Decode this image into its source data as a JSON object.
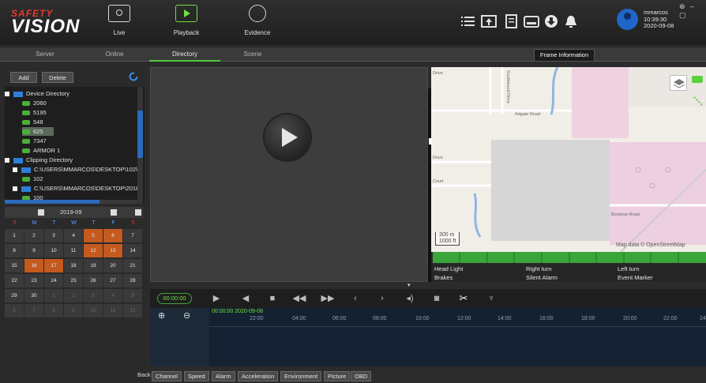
{
  "app": {
    "logo_top": "SAFETY",
    "logo_main": "VISION",
    "nav": [
      {
        "label": "Live"
      },
      {
        "label": "Playback"
      },
      {
        "label": "Evidence"
      }
    ]
  },
  "user": {
    "name": "mmarcos",
    "time": "10:39:30",
    "date": "2020-09-08"
  },
  "window_controls": "⊕ – ▢",
  "subtabs": [
    "Server",
    "Online",
    "Directory",
    "Scene"
  ],
  "tooltip": "Frame Information",
  "left": {
    "add_label": "Add",
    "delete_label": "Delete",
    "tree": [
      {
        "label": "Device Directory",
        "type": "folder"
      },
      {
        "label": "2060",
        "type": "vehicle"
      },
      {
        "label": "5195",
        "type": "vehicle"
      },
      {
        "label": "548",
        "type": "vehicle"
      },
      {
        "label": "625",
        "type": "vehicle"
      },
      {
        "label": "7347",
        "type": "vehicle"
      },
      {
        "label": "ARMOR 1",
        "type": "vehicle"
      },
      {
        "label": "Clipping Directory",
        "type": "folder"
      },
      {
        "label": "C:\\USERS\\MMARCOS\\DESKTOP\\102\\",
        "type": "folder"
      },
      {
        "label": "102",
        "type": "vehicle"
      },
      {
        "label": "C:\\USERS\\MMARCOS\\DESKTOP\\2018_",
        "type": "folder"
      },
      {
        "label": "100",
        "type": "vehicle"
      }
    ],
    "calendar": {
      "month": "2019-09",
      "dow": [
        "S",
        "M",
        "T",
        "W",
        "T",
        "F",
        "S"
      ],
      "weeks": [
        [
          "1",
          "2",
          "3",
          "4",
          "5",
          "6",
          "7"
        ],
        [
          "8",
          "9",
          "10",
          "11",
          "12",
          "13",
          "14"
        ],
        [
          "15",
          "16",
          "17",
          "18",
          "19",
          "20",
          "21"
        ],
        [
          "22",
          "23",
          "24",
          "25",
          "26",
          "27",
          "28"
        ],
        [
          "29",
          "30",
          "1",
          "2",
          "3",
          "4",
          "5"
        ],
        [
          "6",
          "7",
          "8",
          "9",
          "10",
          "11",
          "12"
        ]
      ]
    },
    "back_label": "Back"
  },
  "map": {
    "labels": [
      "Drive",
      "Southwood Drive",
      "Adgate Road",
      "Drive",
      "Court",
      "Buckeye Road"
    ],
    "scale_m": "300 m",
    "scale_ft": "1000 ft",
    "attribution": "Map data © OpenStreetMap"
  },
  "events": [
    {
      "label": "Head Light"
    },
    {
      "label": "Right turn"
    },
    {
      "label": "Left turn"
    },
    {
      "label": "Brakes"
    },
    {
      "label": "Silent Alarm"
    },
    {
      "label": "Event Marker"
    }
  ],
  "player": {
    "time": "00:00:00"
  },
  "timeline": {
    "date_label": "00:00:00 2020-09-08",
    "ticks": [
      "22:00",
      "04:00",
      "06:00",
      "08:00",
      "10:00",
      "12:00",
      "14:00",
      "16:00",
      "18:00",
      "20:00",
      "22:00",
      "24"
    ]
  },
  "bottom_tabs": [
    "Channel",
    "Speed",
    "Alarm",
    "Acceleration",
    "Environment",
    "Picture",
    "OBD"
  ],
  "colors": {
    "accent": "#4ec83a",
    "record_day": "#c45a1e",
    "selection_blue": "#2a6bbd"
  }
}
